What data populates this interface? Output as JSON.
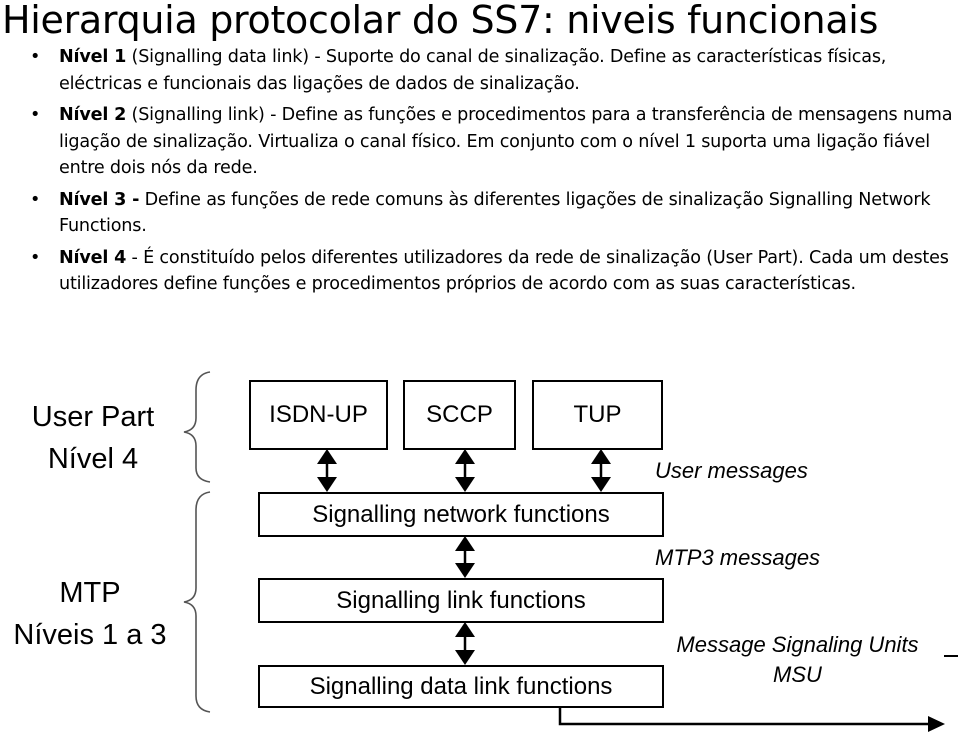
{
  "slide": {
    "title": "Hierarquia protocolar do SS7: niveis funcionais",
    "bullets": [
      {
        "bold": "Nível 1",
        "text": " (Signalling data link) - Suporte do canal de sinalização. Define as características físicas, eléctricas e funcionais das ligações de dados de sinalização."
      },
      {
        "bold": "Nível 2",
        "text": " (Signalling link) - Define as funções e procedimentos para a transferência de mensagens numa ligação de sinalização. Virtualiza o canal físico. Em conjunto com o nível 1 suporta uma ligação fiável entre dois nós da rede."
      },
      {
        "bold": "Nível 3 -",
        "text": " Define as funções de rede comuns às diferentes ligações de sinalização Signalling Network Functions."
      },
      {
        "bold": "Nível 4",
        "text": " - É constituído pelos diferentes utilizadores da rede de sinalização (User Part). Cada um destes utilizadores define funções e procedimentos próprios de acordo com as suas características."
      }
    ],
    "bullet_glyph": "•"
  },
  "diagram": {
    "groups": [
      {
        "line1": "User Part",
        "line2": "Nível 4"
      },
      {
        "line1": "MTP",
        "line2": "Níveis 1 a 3"
      }
    ],
    "user_parts": [
      "ISDN-UP",
      "SCCP",
      "TUP"
    ],
    "layers": [
      "Signalling network functions",
      "Signalling link functions",
      "Signalling data link functions"
    ],
    "messages": {
      "user": "User messages",
      "mtp3": "MTP3 messages",
      "msu_line1": "Message Signaling Units",
      "msu_line2": "MSU"
    }
  }
}
